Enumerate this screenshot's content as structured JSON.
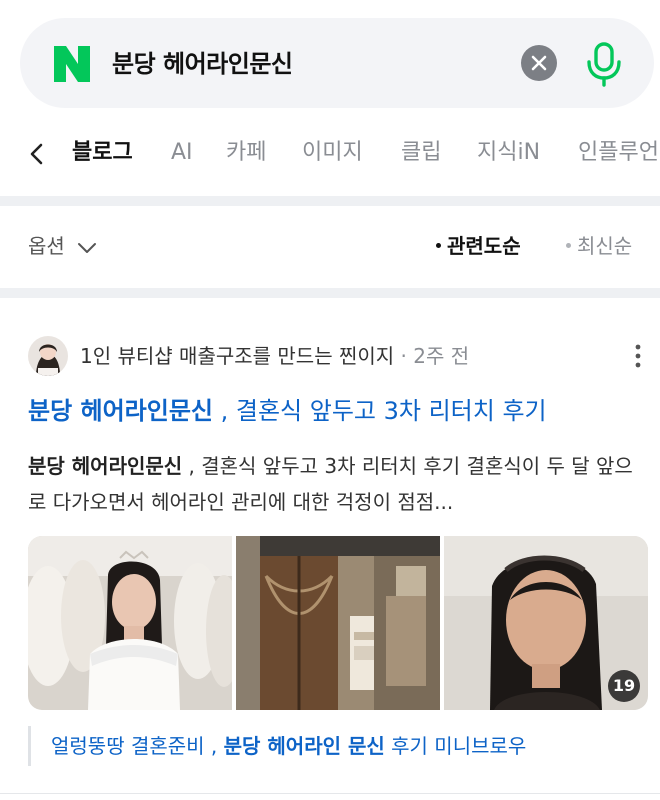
{
  "search": {
    "logo_letter": "N",
    "query": "분당 헤어라인문신",
    "brand_color": "#03c75a"
  },
  "tabs": [
    "블로그",
    "AI",
    "카페",
    "이미지",
    "클립",
    "지식iN",
    "인플루언"
  ],
  "active_tab": "블로그",
  "options": {
    "label": "옵션",
    "sort_relevance": "관련도순",
    "sort_latest": "최신순"
  },
  "result": {
    "author": "1인 뷰티샵 매출구조를 만드는 찐이지",
    "time": "2주 전",
    "title_keyword": "분당 헤어라인문신",
    "title_rest": " , 결혼식 앞두고 3차 리터치 후기",
    "snippet_keyword": "분당 헤어라인문신",
    "snippet_rest": " , 결혼식 앞두고 3차 리터치 후기 결혼식이 두 달 앞으로 다가오면서 헤어라인 관리에 대한 걱정이 점점...",
    "image_count": "19",
    "related_prefix": "얼렁뚱땅 결혼준비 , ",
    "related_keyword": "분당 헤어라인 문신",
    "related_suffix": " 후기 미니브로우"
  },
  "colors": {
    "link": "#0d63c7",
    "separator": "#eef0f3"
  }
}
